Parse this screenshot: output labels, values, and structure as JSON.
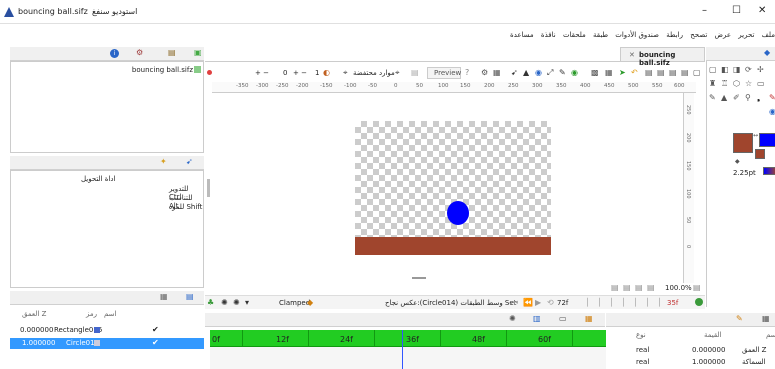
{
  "window": {
    "title": "bouncing ball.sifz",
    "app_name": "استوديو سنفغ",
    "controls": {
      "minimize": "–",
      "maximize": "☐",
      "close": "✕"
    }
  },
  "menubar": {
    "items": [
      "ملف",
      "تحرير",
      "عرض",
      "تصحح",
      "رابطة",
      "صندوق الأدوات",
      "طبقة",
      "ملحقات",
      "نافذة",
      "مساعدة"
    ]
  },
  "canvas_tab": {
    "label": "bouncing ball.sifz",
    "close": "✕"
  },
  "canvas_toolbar": {
    "minus_label": "+ −",
    "value1": "0",
    "plus_label": "+ −",
    "value2": "1",
    "render_label": "موارد محتفضة",
    "preview_label": "Preview"
  },
  "ruler": {
    "labels": [
      "-350",
      "-300",
      "-250",
      "-200",
      "-150",
      "-100",
      "-50",
      "0",
      "50",
      "100",
      "150",
      "200",
      "250",
      "300",
      "350",
      "400",
      "450",
      "500",
      "550",
      "600"
    ],
    "vertical_labels": [
      "250",
      "200",
      "150",
      "100",
      "50",
      "0"
    ]
  },
  "canvas_status": {
    "zoom": "100.0%"
  },
  "timetrack": {
    "interp_label": "Clamped",
    "status_text": "عكس نجاح:(Circle014) وسط الطبقات Set",
    "frame_end": "72f",
    "frame_current": "35f",
    "labels": [
      "0f",
      "12f",
      "24f",
      "36f",
      "48f",
      "60f"
    ]
  },
  "file_panel": {
    "file_name": "bouncing ball.sifz"
  },
  "tool_panel": {
    "title": "اداة التحويل",
    "lines": [
      "للتدوير Ctrl",
      "للتناسب Alt",
      "للمود Shift"
    ]
  },
  "layers_panel": {
    "headers": {
      "z": "العمق Z",
      "icon": "رمز",
      "name": "اسم"
    },
    "rows": [
      {
        "z": "0.000000",
        "name": "Rectangle016",
        "checked": "✔",
        "selected": false
      },
      {
        "z": "1.000000",
        "name": "Circle014",
        "checked": "✔",
        "selected": true
      }
    ]
  },
  "params_panel": {
    "headers": {
      "name": "اسم",
      "value": "القيمة",
      "type": "نوع"
    },
    "rows": [
      {
        "name": "العمق Z",
        "value": "0.000000",
        "type": "real"
      },
      {
        "name": "السماكة",
        "value": "1.000000",
        "type": "real"
      }
    ]
  },
  "right_toolbox": {
    "width_value": "2.25pt"
  },
  "colors": {
    "bar": "#f0f0f0",
    "ball": "#0000ff",
    "ground": "#a0452d",
    "green": "#22cc22",
    "selected": "#3399ff"
  }
}
